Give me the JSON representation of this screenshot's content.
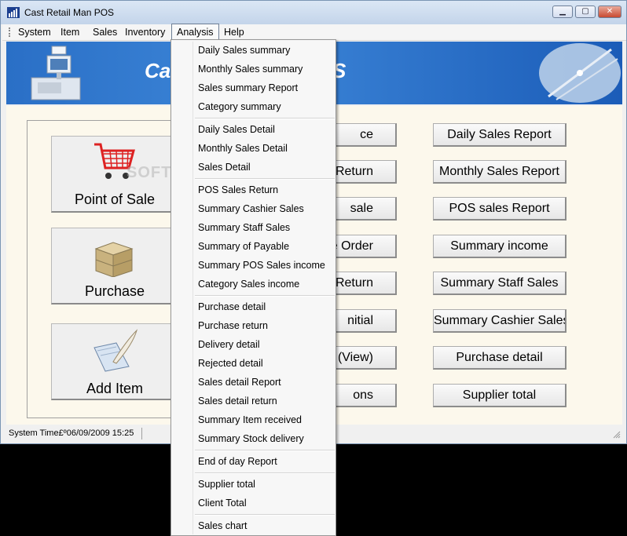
{
  "window": {
    "title": "Cast Retail Man POS"
  },
  "menubar": [
    "System",
    "Item",
    "Sales",
    "Inventory",
    "Analysis",
    "Help"
  ],
  "banner": {
    "title_left": "Cas",
    "title_right": "S"
  },
  "watermark": "SOFTPEDIA",
  "left_buttons": [
    "Point of Sale",
    "Purchase",
    "Add Item"
  ],
  "middle_buttons": [
    "ce",
    "s Return",
    "sale",
    "e Order",
    "Return",
    "nitial",
    "(View)",
    "ons"
  ],
  "right_buttons": [
    "Daily Sales Report",
    "Monthly Sales Report",
    "POS sales Report",
    "Summary income",
    "Summary Staff Sales",
    "Summary Cashier Sales",
    "Purchase detail",
    "Supplier total"
  ],
  "analysis_menu": [
    "Daily Sales summary",
    "Monthly Sales summary",
    "Sales summary Report",
    "Category summary",
    "Daily Sales Detail",
    "Monthly Sales Detail",
    "Sales Detail",
    "POS Sales Return",
    "Summary Cashier Sales",
    "Summary Staff Sales",
    "Summary of Payable",
    "Summary POS Sales income",
    "Category Sales income",
    "Purchase detail",
    "Purchase return",
    "Delivery detail",
    "Rejected detail",
    "Sales detail Report",
    "Sales detail return",
    "Summary Item received",
    "Summary Stock delivery",
    "End of day Report",
    "Supplier total",
    "Client Total",
    "Sales chart"
  ],
  "status": {
    "text": "System Time£º06/09/2009 15:25"
  }
}
